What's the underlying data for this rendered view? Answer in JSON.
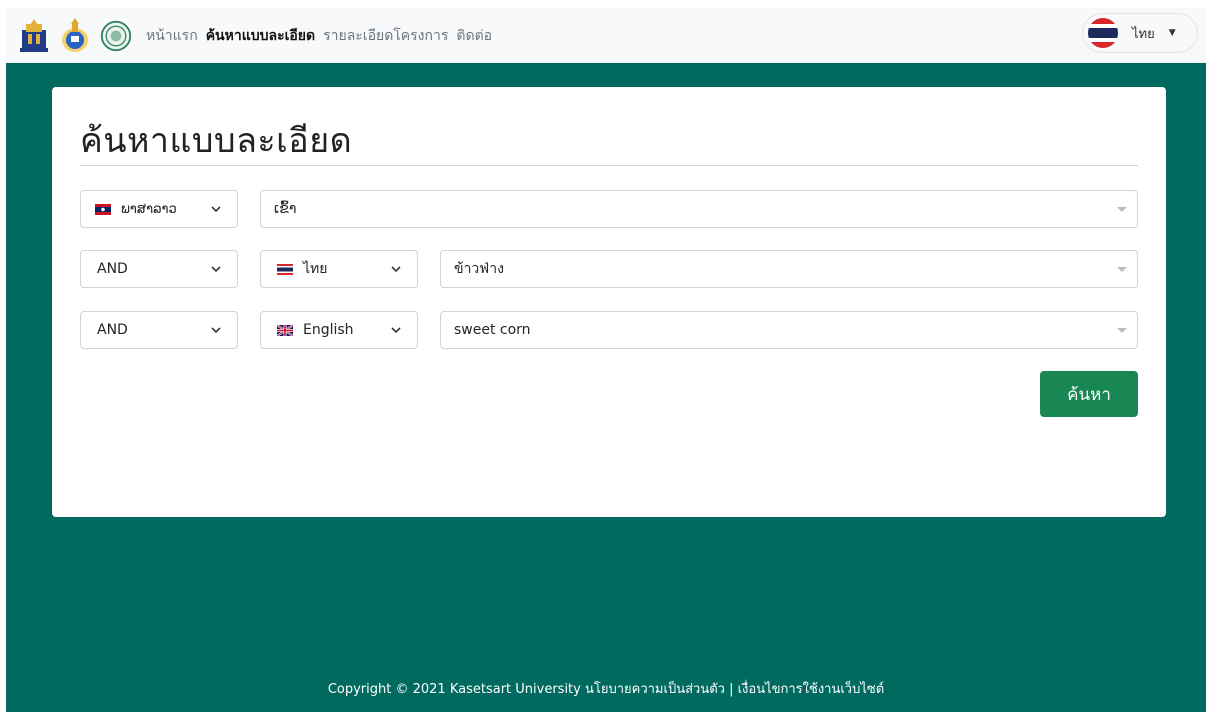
{
  "nav": {
    "links": [
      {
        "label": "หน้าแรก",
        "active": false
      },
      {
        "label": "ค้นหาแบบละเอียด",
        "active": true
      },
      {
        "label": "รายละเอียดโครงการ",
        "active": false
      },
      {
        "label": "ติดต่อ",
        "active": false
      }
    ],
    "language_label": "ไทย"
  },
  "page": {
    "title": "ค้นหาแบบละเอียด"
  },
  "query": {
    "row1": {
      "language": "ພາສາລາວ",
      "term": "ເຂົ້າ"
    },
    "row2": {
      "operator": "AND",
      "language": "ไทย",
      "term": "ข้าวฟ่าง"
    },
    "row3": {
      "operator": "AND",
      "language": "English",
      "term": "sweet corn"
    }
  },
  "search_button_label": "ค้นหา",
  "footer": {
    "text": "Copyright © 2021 Kasetsart University นโยบายความเป็นส่วนตัว | เงื่อนไขการใช้งานเว็บไซต์"
  },
  "colors": {
    "background": "#006a5f",
    "button": "#198754",
    "navbar": "#f8f9fa"
  },
  "icons": [
    "university-seal-icon",
    "royal-emblem-icon",
    "ministry-seal-icon",
    "chevron-down-icon",
    "thai-flag-icon",
    "lao-flag-icon",
    "uk-flag-icon",
    "caret-down-icon"
  ]
}
